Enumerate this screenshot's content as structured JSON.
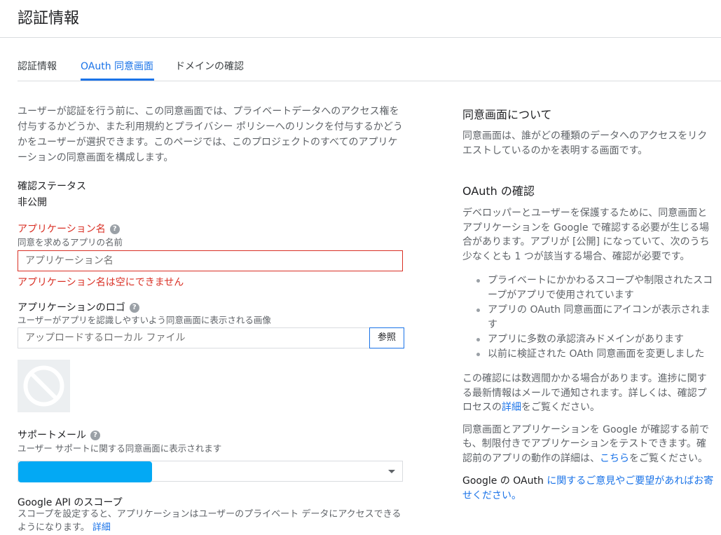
{
  "page": {
    "title": "認証情報"
  },
  "tabs": [
    {
      "label": "認証情報"
    },
    {
      "label": "OAuth 同意画面"
    },
    {
      "label": "ドメインの確認"
    }
  ],
  "intro": "ユーザーが認証を行う前に、この同意画面では、プライベートデータへのアクセス権を付与するかどうか、また利用規約とプライバシー ポリシーへのリンクを付与するかどうかをユーザーが選択できます。このページでは、このプロジェクトのすべてのアプリケーションの同意画面を構成します。",
  "status": {
    "label": "確認ステータス",
    "value": "非公開"
  },
  "app_name": {
    "label": "アプリケーション名",
    "help": "?",
    "sub": "同意を求めるアプリの名前",
    "placeholder": "アプリケーション名",
    "error": "アプリケーション名は空にできません"
  },
  "app_logo": {
    "label": "アプリケーションのロゴ",
    "help": "?",
    "sub": "ユーザーがアプリを認識しやすいよう同意画面に表示される画像",
    "placeholder": "アップロードするローカル ファイル",
    "browse": "参照"
  },
  "support_email": {
    "label": "サポートメール",
    "help": "?",
    "sub": "ユーザー サポートに関する同意画面に表示されます",
    "redact_color": "#03a9f4"
  },
  "scopes": {
    "label": "Google API のスコープ",
    "desc": "スコープを設定すると、アプリケーションはユーザーのプライベート データにアクセスできるようになります。",
    "link": "詳細"
  },
  "about": {
    "heading": "同意画面について",
    "text": "同意画面は、誰がどの種類のデータへのアクセスをリクエストしているのかを表明する画面です。"
  },
  "verify": {
    "heading": "OAuth の確認",
    "text": "デベロッパーとユーザーを保護するために、同意画面とアプリケーションを Google で確認する必要が生じる場合があります。アプリが [公開] になっていて、次のうち少なくとも 1 つが該当する場合、確認が必要です。",
    "bullets": [
      "プライベートにかかわるスコープや制限されたスコープがアプリで使用されています",
      "アプリの OAuth 同意画面にアイコンが表示されます",
      "アプリに多数の承認済みドメインがあります",
      "以前に検証された OAth 同意画面を変更しました"
    ],
    "para2_a": "この確認には数週間かかる場合があります。進捗に関する最新情報はメールで通知されます。詳しくは、確認プロセスの",
    "para2_link": "詳細",
    "para2_b": "をご覧ください。",
    "para3_a": "同意画面とアプリケーションを Google が確認する前でも、制限付きでアプリケーションをテストできます。確認前のアプリの動作の詳細は、",
    "para3_link": "こちら",
    "para3_b": "をご覧ください。",
    "para4_a": "Google の OAuth ",
    "para4_link": "に関するご意見やご要望があればお寄せください。"
  },
  "colors": {
    "accent": "#1a73e8",
    "error": "#d93025"
  }
}
